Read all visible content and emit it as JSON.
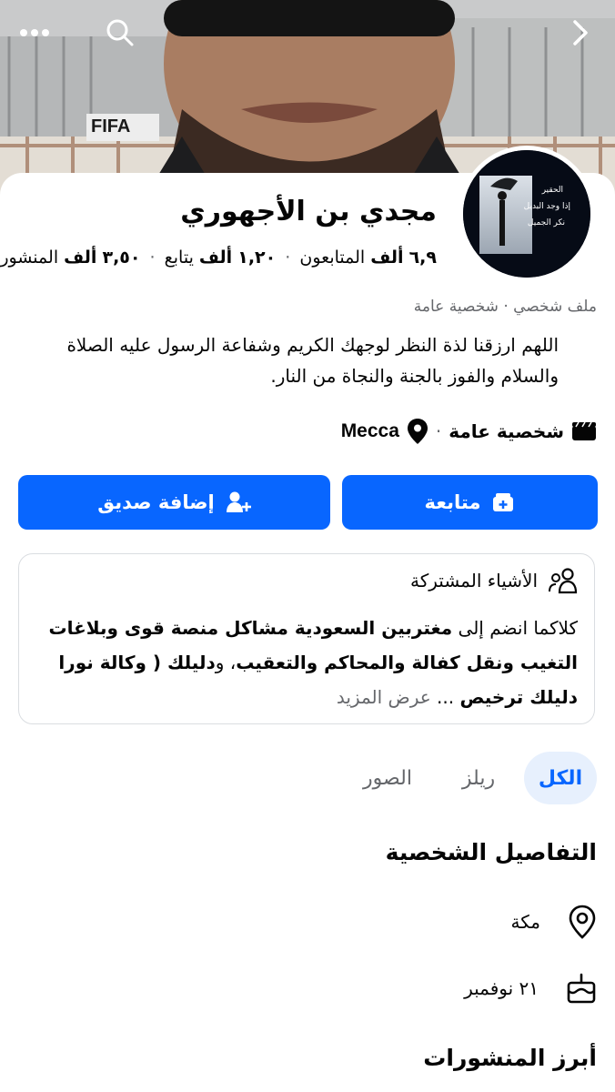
{
  "header": {
    "back_icon": "chevron-right-icon",
    "search_icon": "search-icon",
    "more_icon": "more-dots-icon",
    "cover_text": "FIFA"
  },
  "profile": {
    "name": "مجدي بن الأجهوري",
    "stats": {
      "followers_value": "٦,٩",
      "followers_unit": "ألف",
      "followers_label": "المتابعون",
      "following_value": "١,٢٠",
      "following_unit": "ألف",
      "following_label": "يتابع",
      "posts_value": "٣,٥٠",
      "posts_unit": "ألف",
      "posts_label": "المنشورات",
      "separator": "·"
    },
    "avatar": {
      "line1": "الحقير",
      "line2": "إذا وجد البديل",
      "line3": "نكر الجميل"
    },
    "meta": "ملف شخصي · شخصية عامة",
    "bio": "اللهم ارزقنا لذة النظر لوجهك الكريم وشفاعة الرسول عليه الصلاة والسلام والفوز بالجنة والنجاة من النار.",
    "category": "شخصية عامة",
    "separator": "·",
    "location": "Mecca"
  },
  "actions": {
    "follow_label": "متابعة",
    "add_friend_label": "إضافة صديق"
  },
  "mutual": {
    "title": "الأشياء المشتركة",
    "prefix": "كلاكما انضم إلى",
    "group_bold": "مغتربين السعودية مشاكل منصة قوى وبلاغات التغيب ونقل كفالة والمحاكم والتعقيب",
    "middle": "، و",
    "second_bold": "دليلك ( وكالة نورا دليلك ترخيص",
    "ellipsis": " ... ",
    "see_more": "عرض المزيد"
  },
  "tabs": [
    {
      "label": "الكل",
      "active": true
    },
    {
      "label": "ريلز",
      "active": false
    },
    {
      "label": "الصور",
      "active": false
    }
  ],
  "details": {
    "title": "التفاصيل الشخصية",
    "location": "مكة",
    "birthday": "٢١ نوفمبر"
  },
  "featured": {
    "title": "أبرز المنشورات"
  },
  "colors": {
    "accent": "#0866ff",
    "tab_active_bg": "#e7f0fd",
    "muted": "#65676b"
  }
}
